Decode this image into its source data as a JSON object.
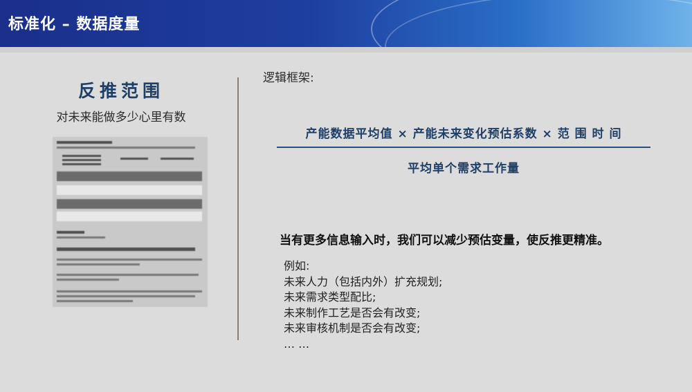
{
  "header": {
    "title": "标准化 – 数据度量"
  },
  "left": {
    "title": "反推范围",
    "subtitle": "对未来能做多少心里有数"
  },
  "right": {
    "logic_label": "逻辑框架:",
    "numerator": "产能数据平均值 × 产能未来变化预估系数 × 范 围 时 间",
    "denominator": "平均单个需求工作量",
    "statement": "当有更多信息输入时，我们可以减少预估变量，使反推更精准。",
    "examples": [
      "例如:",
      "未来人力（包括内外）扩充规划;",
      "未来需求类型配比;",
      "未来制作工艺是否会有改变;",
      "未来审核机制是否会有改变;",
      "… …"
    ]
  },
  "colors": {
    "header_start": "#1a2f8a",
    "header_end": "#6fb3ea",
    "accent_text": "#1f3f66",
    "background": "#dcdcdc"
  }
}
